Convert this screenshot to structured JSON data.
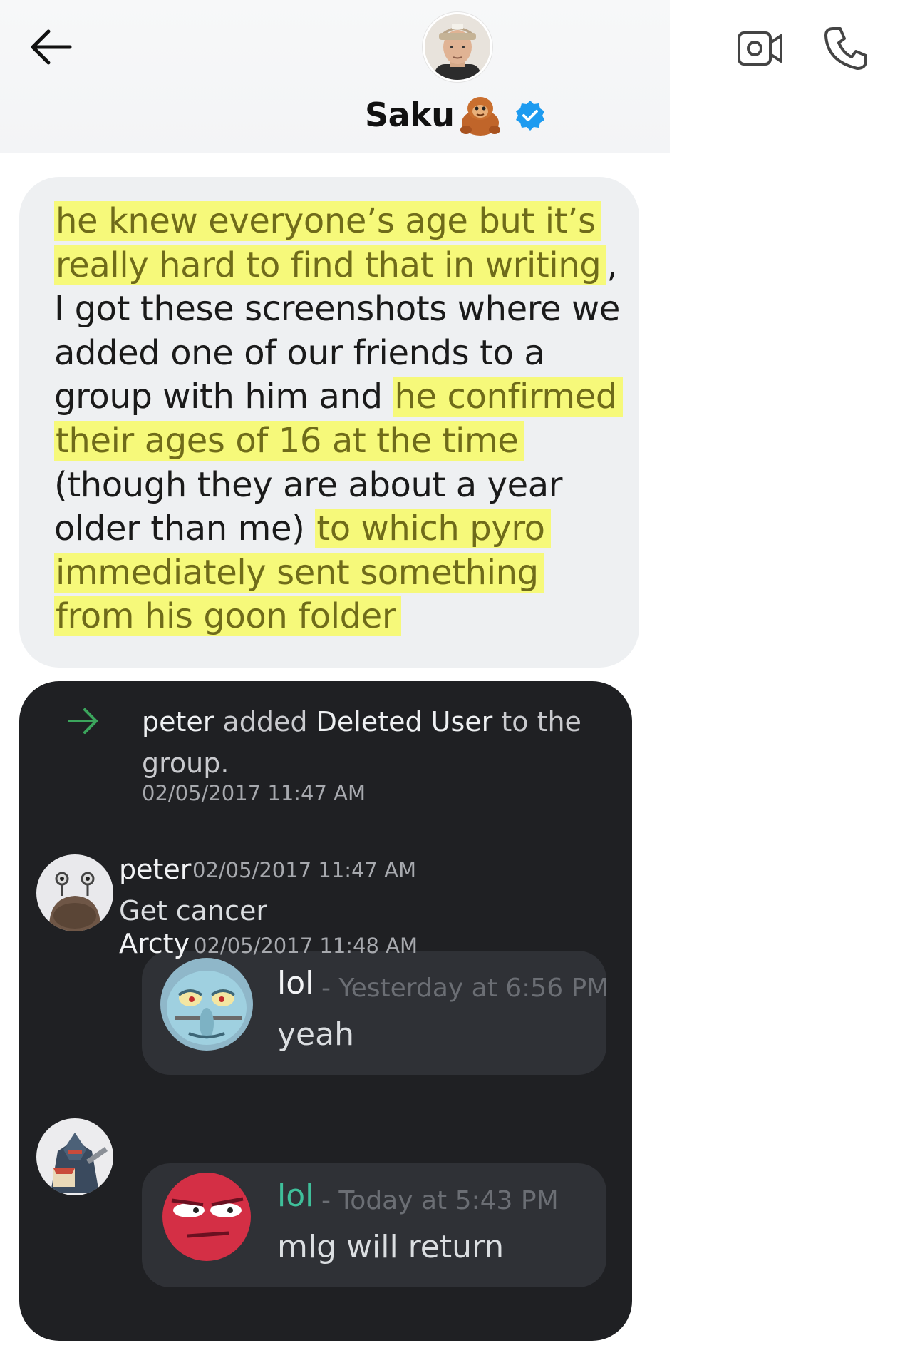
{
  "header": {
    "contact_name": "Saku",
    "verified": true
  },
  "message": {
    "segments": [
      {
        "text": "he knew everyone’s age but it’s really hard to find that in writing",
        "highlight": true
      },
      {
        "text": ", I got these screenshots where we added one of our friends to a group with him and ",
        "highlight": false
      },
      {
        "text": "he confirmed their ages of 16 at the time ",
        "highlight": true
      },
      {
        "text": "(though they are about a year older than me) ",
        "highlight": false
      },
      {
        "text": "to which pyro immediately sent something from his goon folder ",
        "highlight": true
      }
    ]
  },
  "discord": {
    "system": {
      "actor": "peter",
      "verb": " added ",
      "target": "Deleted User",
      "rest": " to the group.",
      "time": "02/05/2017 11:47 AM"
    },
    "messages": [
      {
        "author": "peter",
        "time": "02/05/2017 11:47 AM",
        "text": "Get cancer",
        "embed": {
          "name": "lol",
          "time": " - Yesterday at 6:56 PM",
          "text": "yeah"
        }
      },
      {
        "author": "Arcty",
        "time": "02/05/2017 11:48 AM",
        "text": "",
        "embed": {
          "name": "lol",
          "time": " - Today at 5:43 PM",
          "text": "mlg will return",
          "name_color": "#3fbf9a"
        }
      }
    ]
  },
  "colors": {
    "highlight": "#f6f97a",
    "verified_blue": "#1d9bf0",
    "discord_bg": "#1f2023",
    "arrow_green": "#3ba55c"
  }
}
